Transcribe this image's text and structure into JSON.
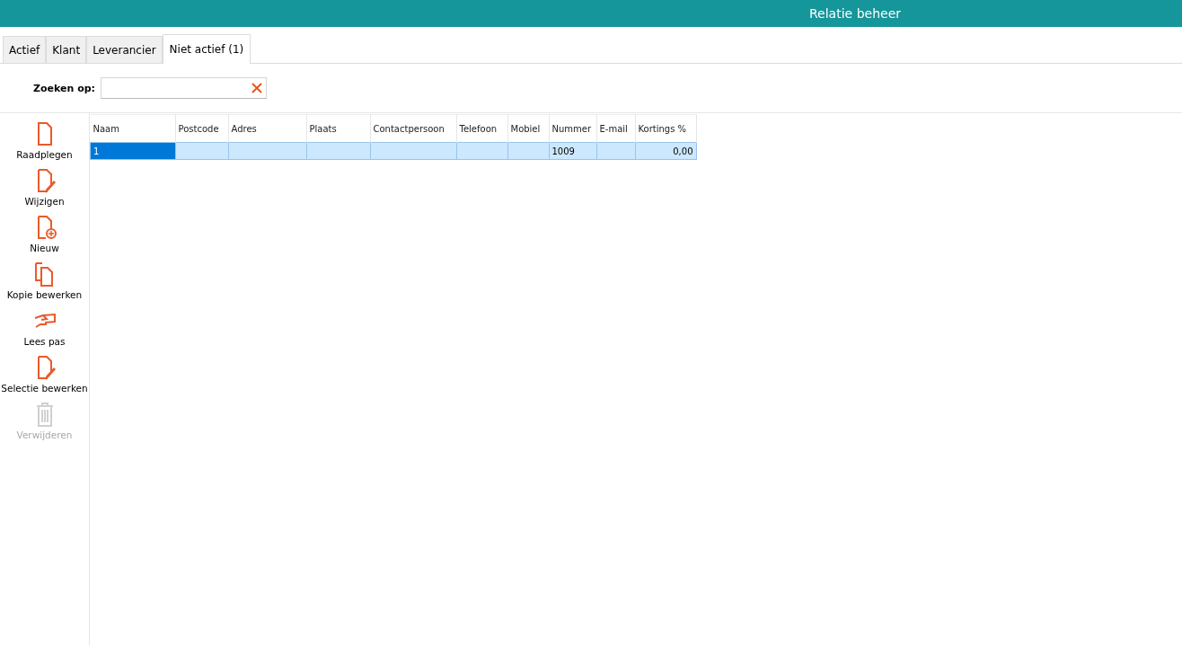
{
  "window": {
    "title": "Relatie beheer"
  },
  "tabs": [
    {
      "label": "Actief",
      "selected": false
    },
    {
      "label": "Klant",
      "selected": false
    },
    {
      "label": "Leverancier",
      "selected": false
    },
    {
      "label": "Niet actief (1)",
      "selected": true
    }
  ],
  "search": {
    "label": "Zoeken op:"
  },
  "actions": [
    {
      "label": "Raadplegen",
      "kind": "document",
      "disabled": false
    },
    {
      "label": "Wijzigen",
      "kind": "edit",
      "disabled": false
    },
    {
      "label": "Nieuw",
      "kind": "new",
      "disabled": false
    },
    {
      "label": "Kopie bewerken",
      "kind": "copy",
      "disabled": false
    },
    {
      "label": "Lees pas",
      "kind": "card",
      "disabled": false
    },
    {
      "label": "Selectie bewerken",
      "kind": "edit",
      "disabled": false
    },
    {
      "label": "Verwijderen",
      "kind": "trash",
      "disabled": true
    }
  ],
  "table": {
    "columns": [
      "Naam",
      "Postcode",
      "Adres",
      "Plaats",
      "Contactpersoon",
      "Telefoon",
      "Mobiel",
      "Nummer",
      "E-mail",
      "Kortings %"
    ],
    "rows": [
      {
        "selected": true,
        "cells": [
          "1",
          "",
          "",
          "",
          "",
          "",
          "",
          "1009",
          "",
          "0,00"
        ]
      }
    ]
  }
}
